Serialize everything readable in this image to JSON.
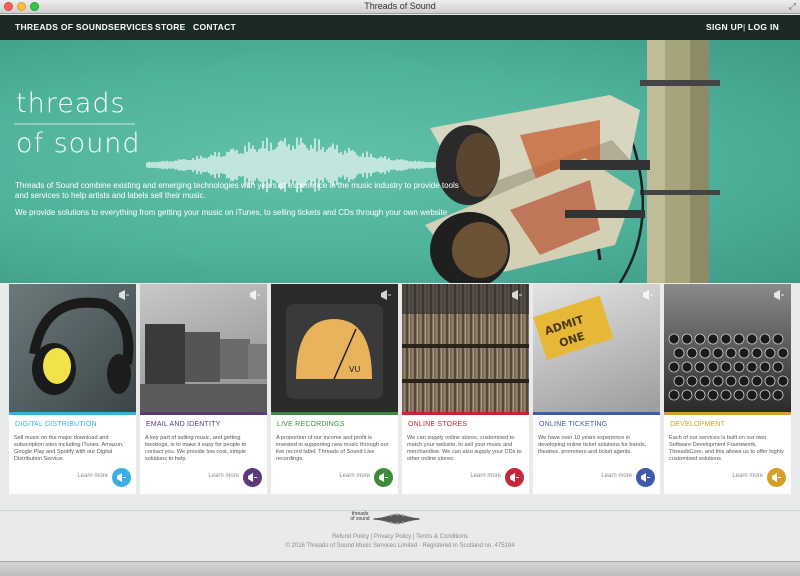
{
  "window": {
    "title": "Threads of Sound"
  },
  "nav": {
    "links": [
      "THREADS OF SOUND",
      "SERVICES",
      "STORE",
      "CONTACT"
    ],
    "signup": "SIGN UP",
    "separator": "|",
    "login": "LOG IN"
  },
  "hero": {
    "logo_line1": "threads",
    "logo_line2": "of sound",
    "paragraph1": "Threads of Sound combine existing and emerging technologies with years of experience in the music industry to provide tools and services to help artists and labels sell their music.",
    "paragraph2": "We provide solutions to everything from getting your music on iTunes, to selling tickets and CDs through your own website"
  },
  "cards": [
    {
      "title": "DIGITAL DISTRIBUTION",
      "color": "#3aaee0",
      "text": "Sell music on the major download and subscription sites including iTunes, Amazon, Google Play and Spotify with our Digital Distribution Service.",
      "more": "Learn more",
      "image": "headphones-photo"
    },
    {
      "title": "EMAIL AND IDENTITY",
      "color": "#5a3a7a",
      "text": "A key part of selling music, and getting bookings, is to make it easy for people to contact you. We provide low cost, simple solutions to help.",
      "more": "Learn more",
      "image": "mailboxes-photo"
    },
    {
      "title": "LIVE RECORDINGS",
      "color": "#3f8a3f",
      "text": "A proportion of our income and profit is invested in supporting new music through our live record label, Threads of Sound Live recordings.",
      "more": "Learn more",
      "image": "vu-meter-photo"
    },
    {
      "title": "ONLINE STORES",
      "color": "#c5283a",
      "text": "We can supply online stores, customised to match your website, to sell your music and merchandise. We can also supply your CDs to other online stores.",
      "more": "Learn more",
      "image": "record-crates-photo"
    },
    {
      "title": "ONLINE TICKETING",
      "color": "#3f5aa8",
      "text": "We have over 10 years experience in developing online ticket solutions for bands, theatres, promoters and ticket agents.",
      "more": "Learn more",
      "image": "admit-one-ticket-photo",
      "ticket_line1": "ADMIT",
      "ticket_line2": "ONE"
    },
    {
      "title": "DEVELOPMENT",
      "color": "#d4a02a",
      "text": "Each of our services is built on our own Software Development Framework, ThreadsCore, and this allows us to offer highly customised solutions.",
      "more": "Learn more",
      "image": "typewriter-photo"
    }
  ],
  "footer": {
    "logo_line1": "threads",
    "logo_line2": "of sound",
    "links": [
      "Refund Policy",
      "Privacy Policy",
      "Terms & Conditions"
    ],
    "separator": "|",
    "copyright": "© 2016 Threads of Sound Music Services Limited - Registered in Scotland no. 475194"
  }
}
